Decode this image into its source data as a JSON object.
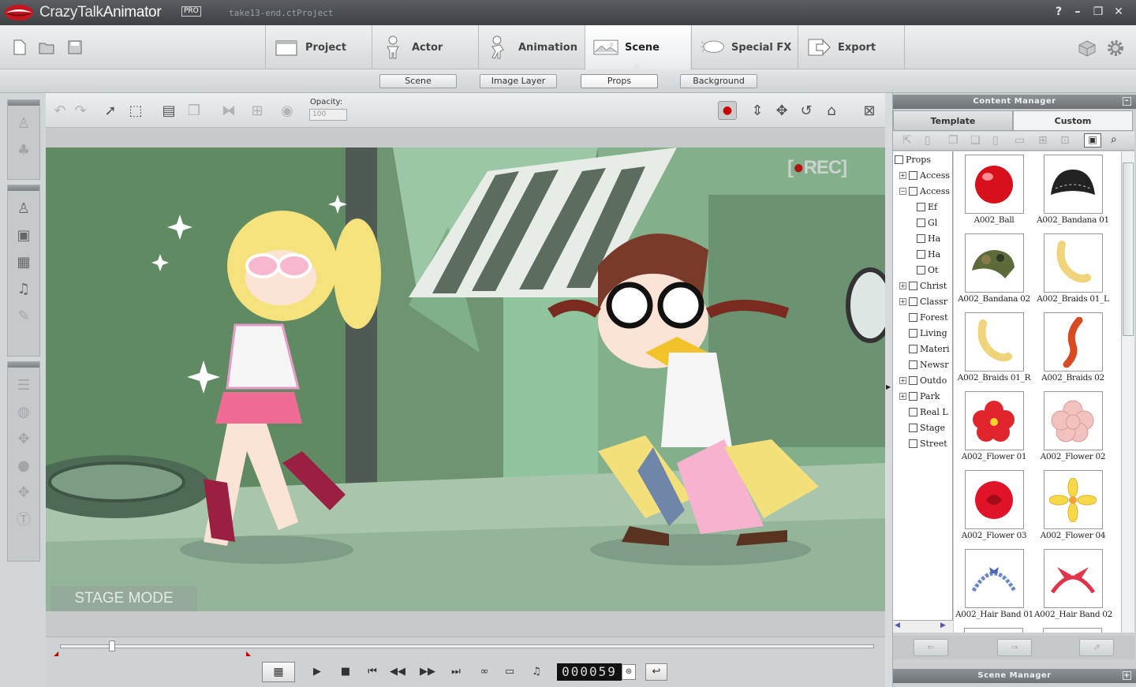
{
  "app": {
    "brand": "CrazyTalk",
    "product": "Animator",
    "edition": "PRO",
    "document_title": "take13-end.ctProject",
    "window_controls": [
      "?",
      "–",
      "❐",
      "✕"
    ]
  },
  "main_tabs": [
    {
      "label": "Project",
      "icon": "project-icon"
    },
    {
      "label": "Actor",
      "icon": "actor-icon"
    },
    {
      "label": "Animation",
      "icon": "animation-icon"
    },
    {
      "label": "Scene",
      "icon": "scene-icon",
      "active": true
    },
    {
      "label": "Special FX",
      "icon": "special-fx-icon"
    },
    {
      "label": "Export",
      "icon": "export-icon"
    }
  ],
  "sub_tabs": [
    {
      "label": "Scene"
    },
    {
      "label": "Image Layer"
    },
    {
      "label": "Props",
      "active": true
    },
    {
      "label": "Background"
    }
  ],
  "stage_toolbar": {
    "opacity_label": "Opacity:",
    "opacity_value": "100"
  },
  "stage": {
    "rec_label": "REC",
    "mode_label": "STAGE MODE"
  },
  "timeline": {
    "frame": "000059",
    "progress": 0.06
  },
  "content_manager": {
    "title": "Content Manager",
    "tabs": [
      {
        "label": "Template",
        "active": true
      },
      {
        "label": "Custom"
      }
    ],
    "tree": [
      {
        "label": "Props",
        "level": 0
      },
      {
        "label": "Access",
        "level": 1,
        "expander": "+"
      },
      {
        "label": "Access",
        "level": 1,
        "expander": "−"
      },
      {
        "label": "Ef",
        "level": 2
      },
      {
        "label": "Gl",
        "level": 2
      },
      {
        "label": "Ha",
        "level": 2
      },
      {
        "label": "Ha",
        "level": 2
      },
      {
        "label": "Ot",
        "level": 2
      },
      {
        "label": "Christ",
        "level": 1,
        "expander": "+"
      },
      {
        "label": "Classr",
        "level": 1,
        "expander": "+"
      },
      {
        "label": "Forest",
        "level": 1
      },
      {
        "label": "Living",
        "level": 1
      },
      {
        "label": "Materi",
        "level": 1
      },
      {
        "label": "Newsr",
        "level": 1
      },
      {
        "label": "Outdo",
        "level": 1,
        "expander": "+"
      },
      {
        "label": "Park",
        "level": 1,
        "expander": "+"
      },
      {
        "label": "Real L",
        "level": 1
      },
      {
        "label": "Stage",
        "level": 1
      },
      {
        "label": "Street",
        "level": 1
      }
    ],
    "items": [
      {
        "label": "A002_Ball",
        "icon": "ball-icon"
      },
      {
        "label": "A002_Bandana 01",
        "icon": "bandana-black-icon"
      },
      {
        "label": "A002_Bandana 02",
        "icon": "bandana-camo-icon"
      },
      {
        "label": "A002_Braids 01_L",
        "icon": "braid-blonde-icon"
      },
      {
        "label": "A002_Braids 01_R",
        "icon": "braid-blonde-icon"
      },
      {
        "label": "A002_Braids 02",
        "icon": "braid-red-icon"
      },
      {
        "label": "A002_Flower 01",
        "icon": "flower-red-icon"
      },
      {
        "label": "A002_Flower 02",
        "icon": "flower-pink-icon"
      },
      {
        "label": "A002_Flower 03",
        "icon": "rose-red-icon"
      },
      {
        "label": "A002_Flower 04",
        "icon": "flower-yellow-icon"
      },
      {
        "label": "A002_Hair Band 01",
        "icon": "hairband-blue-icon"
      },
      {
        "label": "A002_Hair Band 02",
        "icon": "hairband-red-icon"
      }
    ]
  },
  "scene_manager": {
    "title": "Scene Manager"
  },
  "colors": {
    "accent_red": "#cc1b22",
    "stage_green": "#7fa082"
  }
}
